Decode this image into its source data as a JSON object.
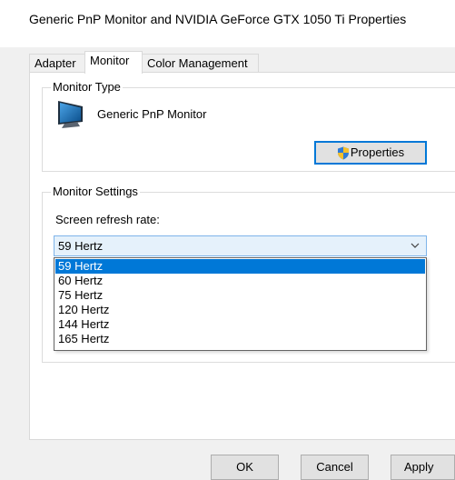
{
  "window": {
    "title": "Generic PnP Monitor and NVIDIA GeForce GTX 1050 Ti Properties"
  },
  "tabs": [
    {
      "label": "Adapter",
      "active": false
    },
    {
      "label": "Monitor",
      "active": true
    },
    {
      "label": "Color Management",
      "active": false
    }
  ],
  "monitor_type": {
    "legend": "Monitor Type",
    "monitor_name": "Generic PnP Monitor",
    "icon": "monitor-icon",
    "properties_button": "Properties"
  },
  "monitor_settings": {
    "legend": "Monitor Settings",
    "refresh_label": "Screen refresh rate:",
    "selected_value": "59 Hertz",
    "options": [
      "59 Hertz",
      "60 Hertz",
      "75 Hertz",
      "120 Hertz",
      "144 Hertz",
      "165 Hertz"
    ],
    "highlighted_option": "59 Hertz"
  },
  "buttons": {
    "ok": "OK",
    "cancel": "Cancel",
    "apply": "Apply"
  },
  "colors": {
    "accent": "#0078d7",
    "combo_bg": "#e5f1fb",
    "dialog_bg": "#f0f0f0"
  }
}
